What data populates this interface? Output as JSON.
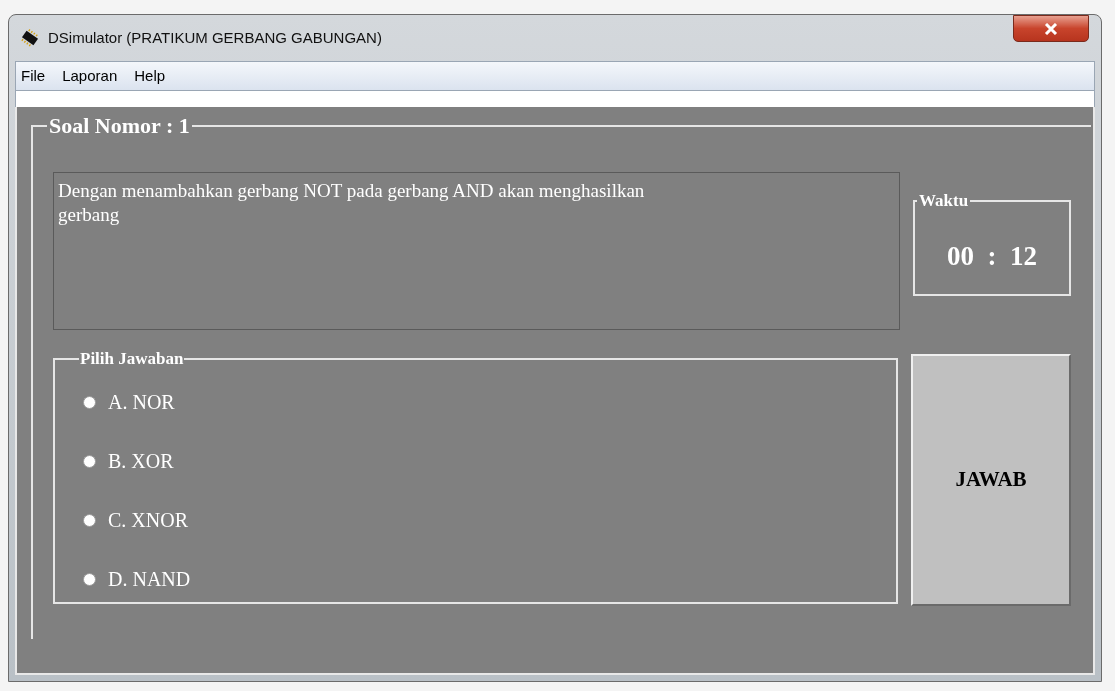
{
  "window": {
    "title": "DSimulator (PRATIKUM GERBANG GABUNGAN)"
  },
  "menu": [
    "File",
    "Laporan",
    "Help"
  ],
  "question_group": {
    "legend": "Soal Nomor : 1",
    "text": "Dengan menambahkan gerbang NOT pada gerbang AND akan menghasilkan gerbang"
  },
  "timer": {
    "legend": "Waktu",
    "value": "00  :  12"
  },
  "answers": {
    "legend": "Pilih Jawaban",
    "options": [
      {
        "label": "A. NOR",
        "selected": false
      },
      {
        "label": "B. XOR",
        "selected": false
      },
      {
        "label": "C. XNOR",
        "selected": false
      },
      {
        "label": "D. NAND",
        "selected": false
      }
    ]
  },
  "submit_button": "JAWAB"
}
